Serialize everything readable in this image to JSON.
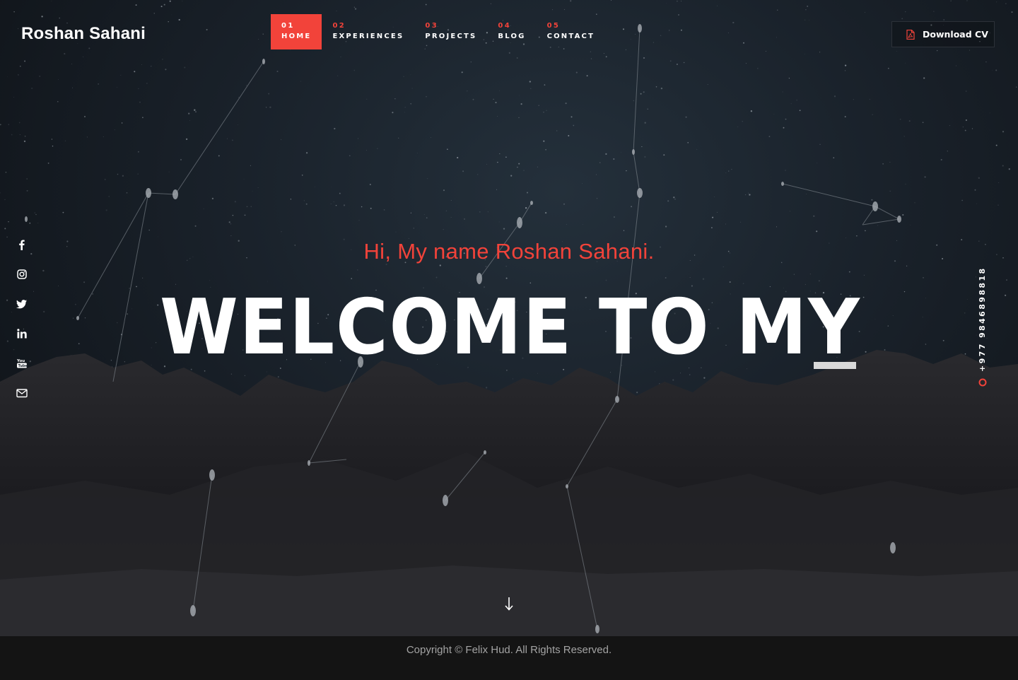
{
  "header": {
    "brand": "Roshan Sahani",
    "nav": [
      {
        "num": "01",
        "label": "HOME",
        "active": true
      },
      {
        "num": "02",
        "label": "EXPERIENCES",
        "active": false
      },
      {
        "num": "03",
        "label": "PROJECTS",
        "active": false
      },
      {
        "num": "04",
        "label": "BLOG",
        "active": false
      },
      {
        "num": "05",
        "label": "CONTACT",
        "active": false
      }
    ],
    "cv_button": {
      "label": "Download CV",
      "icon": "pdf-file-icon"
    }
  },
  "social": [
    {
      "name": "facebook",
      "icon": "facebook-icon"
    },
    {
      "name": "instagram",
      "icon": "instagram-icon"
    },
    {
      "name": "twitter",
      "icon": "twitter-icon"
    },
    {
      "name": "linkedin",
      "icon": "linkedin-icon"
    },
    {
      "name": "youtube",
      "icon": "youtube-icon"
    },
    {
      "name": "email",
      "icon": "envelope-icon"
    }
  ],
  "hero": {
    "greeting": "Hi, My name Roshan Sahani.",
    "headline": "WELCOME TO MY",
    "phone": "+977 9846898818",
    "scroll_icon": "arrow-down-icon"
  },
  "footer": {
    "copyright": "Copyright © Felix Hud. All Rights Reserved."
  },
  "colors": {
    "accent": "#f2433a",
    "background": "#12171d",
    "footer_bg": "#141414",
    "text": "#ffffff"
  }
}
